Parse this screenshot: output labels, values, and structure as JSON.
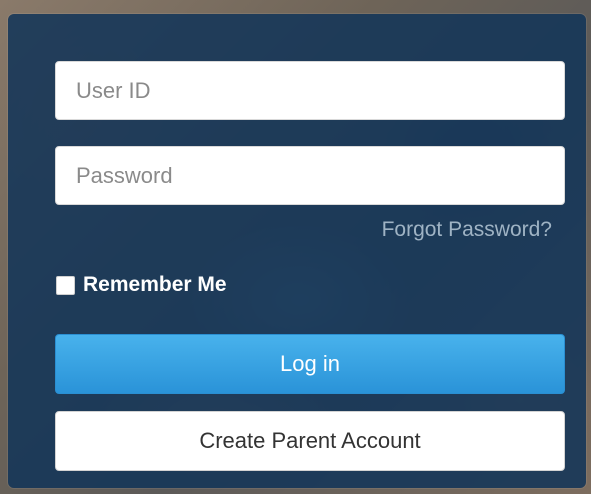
{
  "login_form": {
    "user_id": {
      "placeholder": "User ID",
      "value": ""
    },
    "password": {
      "placeholder": "Password",
      "value": ""
    },
    "forgot_password_label": "Forgot Password?",
    "remember_me": {
      "label": "Remember Me",
      "checked": false
    },
    "login_label": "Log in",
    "create_account_label": "Create Parent Account"
  },
  "colors": {
    "overlay": "#123458",
    "login_button": "#3aa3e2",
    "forgot_link": "#9fb3c4"
  }
}
